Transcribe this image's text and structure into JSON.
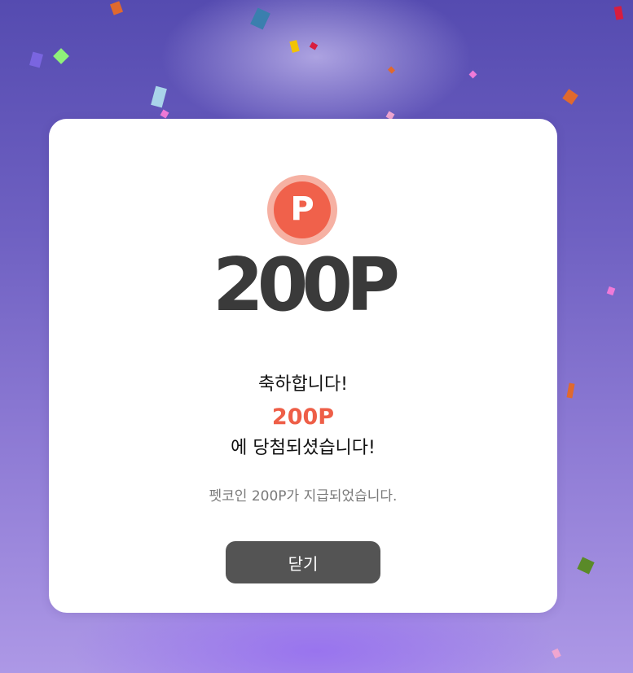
{
  "dialog": {
    "coin_letter": "P",
    "amount_display": "200P",
    "congrats_text": "축하합니다!",
    "prize_amount": "200P",
    "won_text": "에 당첨되셨습니다!",
    "sub_message": "펫코인 200P가 지급되었습니다.",
    "close_label": "닫기"
  },
  "colors": {
    "accent": "#ee5e47",
    "coin_outer": "#f6b1a3",
    "coin_inner": "#f0614b",
    "button_bg": "#545454",
    "amount_text": "#3a3a3a",
    "background_top": "#554bb0",
    "background_bottom": "#ad98e6"
  }
}
